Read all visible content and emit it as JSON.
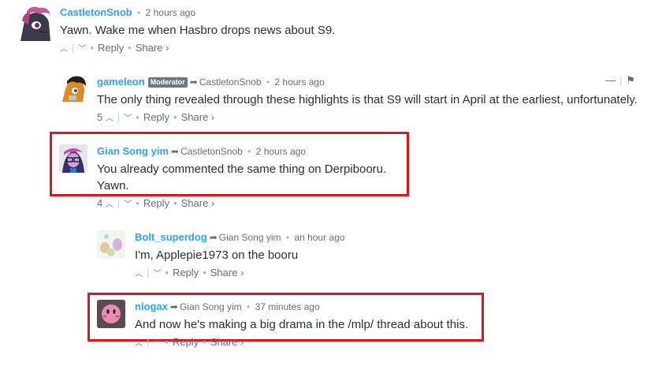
{
  "comments": [
    {
      "author": "CastletonSnob",
      "time": "2 hours ago",
      "body": "Yawn. Wake me when Hasbro drops news about S9.",
      "votes": "",
      "reply_label": "Reply",
      "share_label": "Share ›",
      "avatar_icon": "pony-avatar-icon"
    },
    {
      "author": "gameleon",
      "badge": "Moderator",
      "reply_to": "CastletonSnob",
      "time": "2 hours ago",
      "body": "The only thing revealed through these highlights is that S9 will start in April at the earliest, unfortunately.",
      "votes": "5",
      "reply_label": "Reply",
      "share_label": "Share ›",
      "avatar_icon": "pony-avatar-icon"
    },
    {
      "author": "Gian Song yim",
      "reply_to": "CastletonSnob",
      "time": "2 hours ago",
      "body_line1": "You already commented the same thing on Derpibooru.",
      "body_line2": "Yawn.",
      "votes": "4",
      "reply_label": "Reply",
      "share_label": "Share ›",
      "avatar_icon": "character-avatar-icon"
    },
    {
      "author": "Bolt_superdog",
      "reply_to": "Gian Song yim",
      "time": "an hour ago",
      "body": "I'm, Applepie1973 on the booru",
      "votes": "",
      "reply_label": "Reply",
      "share_label": "Share ›",
      "avatar_icon": "pony-avatar-icon"
    },
    {
      "author": "nlogax",
      "reply_to": "Gian Song yim",
      "time": "37 minutes ago",
      "body": "And now he's making a big drama in the /mlp/ thread about this.",
      "votes": "",
      "reply_label": "Reply",
      "share_label": "Share ›",
      "avatar_icon": "kirby-avatar-icon"
    }
  ],
  "mod_tools": {
    "collapse": "—",
    "flag": "⚑"
  },
  "colors": {
    "author": "#2e9fff",
    "highlight": "#e0141e",
    "text": "#2a2e2e",
    "meta": "#656c7a"
  }
}
